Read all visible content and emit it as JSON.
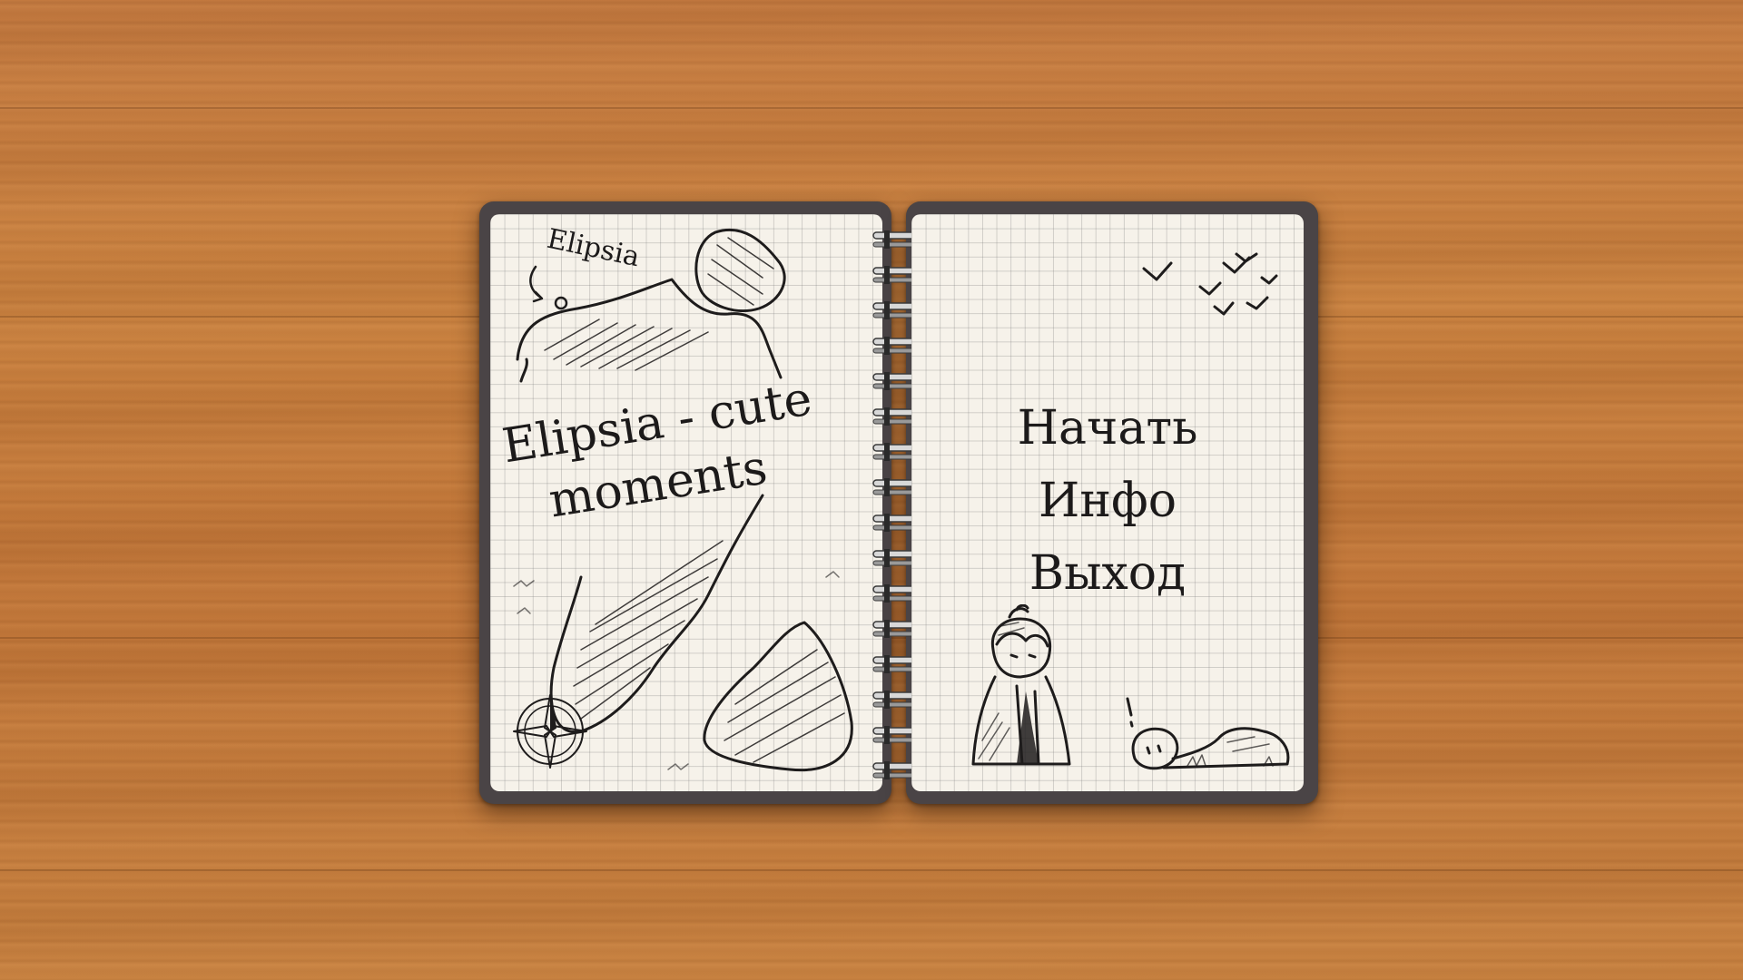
{
  "map": {
    "label": "Elipsia"
  },
  "title": {
    "line1": "Elipsia - cute",
    "line2": "moments"
  },
  "menu": {
    "items": [
      {
        "id": "start",
        "label": "Начать"
      },
      {
        "id": "info",
        "label": "Инфо"
      },
      {
        "id": "exit",
        "label": "Выход"
      }
    ]
  },
  "colors": {
    "desk": "#c47a40",
    "cover": "#4a4446",
    "paper": "#f6f2ea",
    "ink": "#1e1c1c"
  },
  "icons": [
    "compass-icon",
    "birds-icon",
    "spiral-binding-icon"
  ]
}
